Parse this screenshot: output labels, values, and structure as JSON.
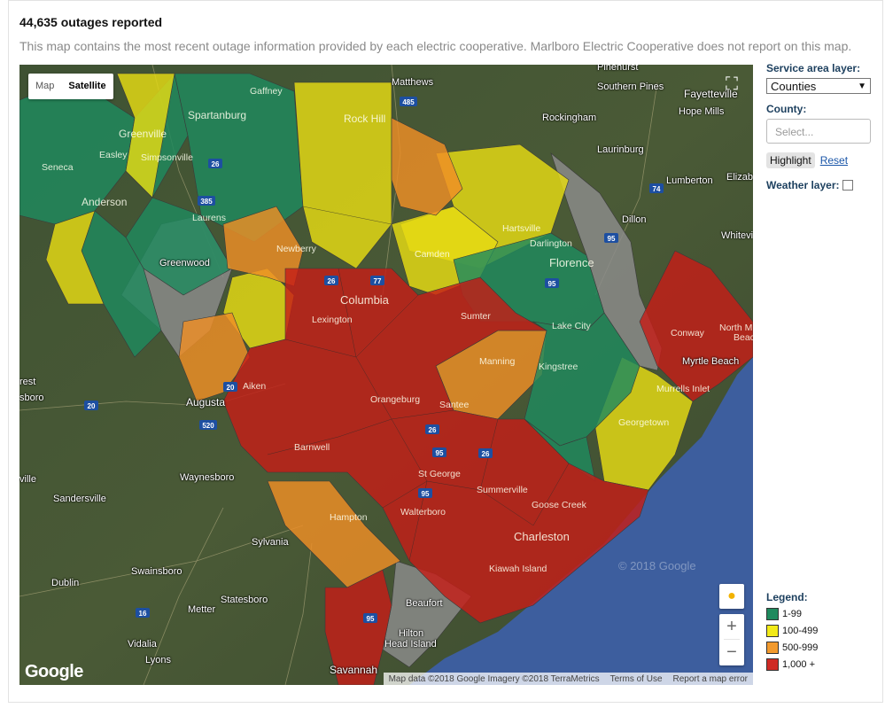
{
  "header": {
    "title": "44,635 outages reported",
    "description": "This map contains the most recent outage information provided by each electric cooperative. Marlboro Electric Cooperative does not report on this map."
  },
  "map": {
    "type_map": "Map",
    "type_satellite": "Satellite",
    "fullscreen_icon": "fullscreen-icon",
    "google_logo": "Google",
    "watermark": "© 2018 Google",
    "attribution": {
      "data": "Map data ©2018 Google Imagery ©2018 TerraMetrics",
      "terms": "Terms of Use",
      "report": "Report a map error"
    },
    "zoom_in": "+",
    "zoom_out": "−",
    "labels": {
      "matthews": "Matthews",
      "pinehurst": "Pinehurst",
      "southern_pines": "Southern Pines",
      "fayetteville": "Fayetteville",
      "hope_mills": "Hope Mills",
      "rockingham": "Rockingham",
      "laurinburg": "Laurinburg",
      "lumberton": "Lumberton",
      "elizab": "Elizab",
      "dillon": "Dillon",
      "whitevi": "Whitevi",
      "gaffney": "Gaffney",
      "spartanburg": "Spartanburg",
      "rock_hill": "Rock Hill",
      "greenville": "Greenville",
      "simpsonville": "Simpsonville",
      "easley": "Easley",
      "seneca": "Seneca",
      "anderson": "Anderson",
      "laurens": "Laurens",
      "greenwood": "Greenwood",
      "newberry": "Newberry",
      "camden": "Camden",
      "hartsville": "Hartsville",
      "darlington": "Darlington",
      "florence": "Florence",
      "columbia": "Columbia",
      "lexington": "Lexington",
      "sumter": "Sumter",
      "lake_city": "Lake City",
      "conway": "Conway",
      "north_m": "North M",
      "beach": "Beac",
      "myrtle_beach": "Myrtle Beach",
      "murrells_inlet": "Murrells Inlet",
      "manning": "Manning",
      "kingstree": "Kingstree",
      "georgetown": "Georgetown",
      "aiken": "Aiken",
      "augusta": "Augusta",
      "orangeburg": "Orangeburg",
      "santee": "Santee",
      "barnwell": "Barnwell",
      "waynesboro": "Waynesboro",
      "st_george": "St George",
      "summerville": "Summerville",
      "goose_creek": "Goose Creek",
      "walterboro": "Walterboro",
      "charleston": "Charleston",
      "kiawah": "Kiawah Island",
      "hampton": "Hampton",
      "sandersville": "Sandersville",
      "sylvania": "Sylvania",
      "swainsboro": "Swainsboro",
      "dublin": "Dublin",
      "statesboro": "Statesboro",
      "metter": "Metter",
      "vidalia": "Vidalia",
      "lyons": "Lyons",
      "beaufort": "Beaufort",
      "hilton_head": "Hilton",
      "hilton_head2": "Head Island",
      "savannah": "Savannah",
      "rest": "rest",
      "sboro": "sboro",
      "ville": "ville"
    },
    "shields": {
      "i485": "485",
      "i26a": "26",
      "i385": "385",
      "i74": "74",
      "i95a": "95",
      "i95b": "95",
      "i20a": "20",
      "i20b": "20",
      "i520": "520",
      "i77": "77",
      "i26b": "26",
      "i26c": "26",
      "i95c": "95",
      "i95d": "95",
      "i16": "16",
      "i95e": "95",
      "i26d": "26"
    }
  },
  "sidebar": {
    "service_area_label": "Service area layer:",
    "service_area_value": "Counties",
    "county_label": "County:",
    "county_placeholder": "Select...",
    "highlight_label": "Highlight",
    "reset_label": "Reset",
    "weather_label": "Weather layer:"
  },
  "legend": {
    "title": "Legend:",
    "items": [
      {
        "label": "1-99",
        "color": "#1f8a5e"
      },
      {
        "label": "100-499",
        "color": "#f2ea18"
      },
      {
        "label": "500-999",
        "color": "#f29a2e"
      },
      {
        "label": "1,000 +",
        "color": "#cf2b25"
      }
    ]
  },
  "colors": {
    "green": "#1f8a5e",
    "yellow": "#e6dc14",
    "orange": "#ef8f26",
    "red": "#c41d17",
    "gray": "#8c8c8c"
  }
}
